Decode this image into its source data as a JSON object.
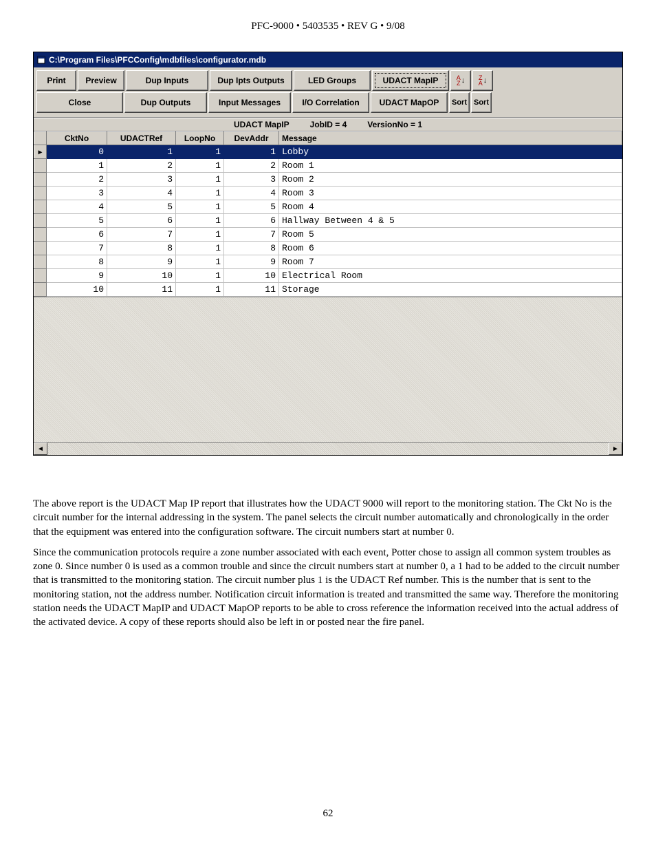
{
  "page_header": "PFC-9000 • 5403535 • REV G • 9/08",
  "window": {
    "title": "C:\\Program Files\\PFCConfig\\mdbfiles\\configurator.mdb",
    "row1": {
      "print": "Print",
      "preview": "Preview",
      "dup_inputs": "Dup Inputs",
      "dup_ipts_outputs": "Dup Ipts Outputs",
      "led_groups": "LED Groups",
      "udact_mapip": "UDACT MapIP"
    },
    "row2": {
      "close": "Close",
      "dup_outputs": "Dup Outputs",
      "input_messages": "Input Messages",
      "io_correlation": "I/O Correlation",
      "udact_mapop": "UDACT MapOP",
      "sort1": "Sort",
      "sort2": "Sort"
    },
    "strip": {
      "title": "UDACT MapIP",
      "jobid": "JobID = 4",
      "version": "VersionNo = 1"
    },
    "columns": {
      "cktno": "CktNo",
      "udactref": "UDACTRef",
      "loopno": "LoopNo",
      "devaddr": "DevAddr",
      "message": "Message"
    },
    "rows": [
      {
        "ckt": "0",
        "ref": "1",
        "loop": "1",
        "addr": "1",
        "msg": "Lobby"
      },
      {
        "ckt": "1",
        "ref": "2",
        "loop": "1",
        "addr": "2",
        "msg": "Room 1"
      },
      {
        "ckt": "2",
        "ref": "3",
        "loop": "1",
        "addr": "3",
        "msg": "Room 2"
      },
      {
        "ckt": "3",
        "ref": "4",
        "loop": "1",
        "addr": "4",
        "msg": "Room 3"
      },
      {
        "ckt": "4",
        "ref": "5",
        "loop": "1",
        "addr": "5",
        "msg": "Room 4"
      },
      {
        "ckt": "5",
        "ref": "6",
        "loop": "1",
        "addr": "6",
        "msg": "Hallway        Between 4 & 5"
      },
      {
        "ckt": "6",
        "ref": "7",
        "loop": "1",
        "addr": "7",
        "msg": "Room 5"
      },
      {
        "ckt": "7",
        "ref": "8",
        "loop": "1",
        "addr": "8",
        "msg": "Room 6"
      },
      {
        "ckt": "8",
        "ref": "9",
        "loop": "1",
        "addr": "9",
        "msg": "Room 7"
      },
      {
        "ckt": "9",
        "ref": "10",
        "loop": "1",
        "addr": "10",
        "msg": "Electrical Room"
      },
      {
        "ckt": "10",
        "ref": "11",
        "loop": "1",
        "addr": "11",
        "msg": "Storage"
      }
    ]
  },
  "body": {
    "p1": "The above report is the UDACT Map IP report that illustrates how the UDACT 9000 will report to the monitoring station. The Ckt No is the circuit number for the internal addressing in the system. The panel selects the circuit number automatically and chronologically in the order that the equipment was entered into the configuration software. The circuit numbers start at number 0.",
    "p2": "Since the communication protocols require a zone number associated with each event, Potter chose to assign all common system troubles as zone 0.  Since number 0 is used as a common trouble and since the circuit numbers start at number 0, a 1 had to be added to the circuit number that is transmitted to the monitoring station. The circuit number plus 1 is the UDACT Ref number. This is the number that is sent to the monitoring station, not the address number. Notification circuit information is treated and transmitted the same way. Therefore the monitoring station needs the UDACT MapIP and UDACT MapOP reports to be able to cross reference the information received into the actual address of the activated device. A copy of these reports should also be left in or posted near the fire panel."
  },
  "page_number": "62"
}
